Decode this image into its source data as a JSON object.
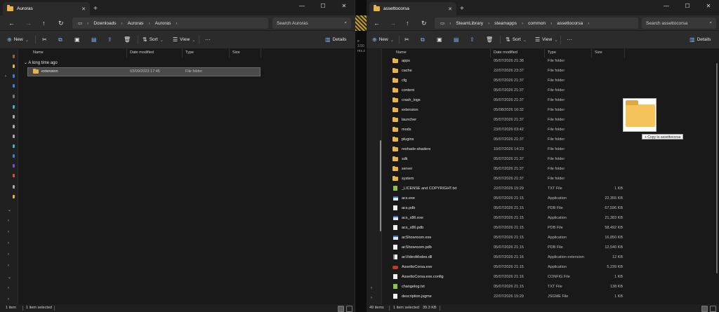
{
  "left": {
    "tab_title": "Auroras",
    "breadcrumbs": [
      "Downloads",
      "Auroras",
      "Auroras"
    ],
    "search_placeholder": "Search Auroras",
    "cmd": {
      "new": "New",
      "sort": "Sort",
      "view": "View",
      "more": "···",
      "details": "Details"
    },
    "columns": {
      "name": "Name",
      "date": "Date modified",
      "type": "Type",
      "size": "Size"
    },
    "group_label": "A long time ago",
    "files": [
      {
        "name": "extension",
        "date": "03/09/2023 17:45",
        "type": "File folder",
        "size": "",
        "icon": "folder-icon"
      }
    ],
    "status": {
      "items": "1 item",
      "selected": "1 item selected"
    }
  },
  "right": {
    "tab_title": "assettocorsa",
    "breadcrumbs": [
      "SteamLibrary",
      "steamapps",
      "common",
      "assettocorsa"
    ],
    "search_placeholder": "Search assettocorsa",
    "cmd": {
      "new": "New",
      "sort": "Sort",
      "view": "View",
      "more": "···",
      "details": "Details"
    },
    "columns": {
      "name": "Name",
      "date": "Date modified",
      "type": "Type",
      "size": "Size"
    },
    "files": [
      {
        "name": "apps",
        "date": "05/07/2026 21:38",
        "type": "File folder",
        "size": "",
        "icon": "folder-icon"
      },
      {
        "name": "cache",
        "date": "22/07/2026 23:37",
        "type": "File folder",
        "size": "",
        "icon": "folder-icon"
      },
      {
        "name": "cfg",
        "date": "05/07/2026 21:37",
        "type": "File folder",
        "size": "",
        "icon": "folder-icon"
      },
      {
        "name": "content",
        "date": "05/07/2026 21:37",
        "type": "File folder",
        "size": "",
        "icon": "folder-icon"
      },
      {
        "name": "crash_logs",
        "date": "05/07/2026 21:37",
        "type": "File folder",
        "size": "",
        "icon": "folder-icon"
      },
      {
        "name": "extension",
        "date": "05/08/2026 16:32",
        "type": "File folder",
        "size": "",
        "icon": "folder-icon"
      },
      {
        "name": "launcher",
        "date": "05/07/2026 21:37",
        "type": "File folder",
        "size": "",
        "icon": "folder-icon"
      },
      {
        "name": "mods",
        "date": "23/07/2026 03:42",
        "type": "File folder",
        "size": "",
        "icon": "folder-icon"
      },
      {
        "name": "plugins",
        "date": "05/07/2026 21:37",
        "type": "File folder",
        "size": "",
        "icon": "folder-icon"
      },
      {
        "name": "reshade-shaders",
        "date": "10/07/2026 14:23",
        "type": "File folder",
        "size": "",
        "icon": "folder-icon"
      },
      {
        "name": "sdk",
        "date": "05/07/2026 21:37",
        "type": "File folder",
        "size": "",
        "icon": "folder-icon"
      },
      {
        "name": "server",
        "date": "05/07/2026 21:37",
        "type": "File folder",
        "size": "",
        "icon": "folder-icon"
      },
      {
        "name": "system",
        "date": "05/07/2026 21:37",
        "type": "File folder",
        "size": "",
        "icon": "folder-icon"
      },
      {
        "name": "_LICENSE and COPYRIGHT.txt",
        "date": "22/07/2026 15:29",
        "type": "TXT File",
        "size": "1 KB",
        "icon": "text-file-icon"
      },
      {
        "name": "acs.exe",
        "date": "05/07/2026 21:15",
        "type": "Application",
        "size": "22,355 KB",
        "icon": "application-icon"
      },
      {
        "name": "acs.pdb",
        "date": "05/07/2026 21:15",
        "type": "PDB File",
        "size": "67,596 KB",
        "icon": "file-icon"
      },
      {
        "name": "acs_x86.exe",
        "date": "05/07/2026 21:15",
        "type": "Application",
        "size": "21,383 KB",
        "icon": "application-icon"
      },
      {
        "name": "acs_x86.pdb",
        "date": "05/07/2026 21:15",
        "type": "PDB File",
        "size": "58,492 KB",
        "icon": "file-icon"
      },
      {
        "name": "acShowroom.exe",
        "date": "05/07/2026 21:15",
        "type": "Application",
        "size": "16,850 KB",
        "icon": "application-icon"
      },
      {
        "name": "acShowroom.pdb",
        "date": "05/07/2026 21:15",
        "type": "PDB File",
        "size": "12,540 KB",
        "icon": "file-icon"
      },
      {
        "name": "acVideoModes.dll",
        "date": "05/07/2026 21:16",
        "type": "Application extension",
        "size": "12 KB",
        "icon": "dll-icon"
      },
      {
        "name": "AssettoCorsa.exe",
        "date": "05/07/2026 21:15",
        "type": "Application",
        "size": "5,239 KB",
        "icon": "assettocorsa-app-icon"
      },
      {
        "name": "AssettoCorsa.exe.config",
        "date": "05/07/2026 21:16",
        "type": "CONFIG File",
        "size": "1 KB",
        "icon": "file-icon"
      },
      {
        "name": "changelog.txt",
        "date": "05/07/2026 21:15",
        "type": "TXT File",
        "size": "138 KB",
        "icon": "text-file-icon"
      },
      {
        "name": "description.jsgme",
        "date": "22/07/2026 15:29",
        "type": "JSGME File",
        "size": "1 KB",
        "icon": "file-icon"
      }
    ],
    "status": {
      "items": "49 items",
      "selected": "1 item selected",
      "size": "39.3 KB"
    }
  },
  "drag_tooltip": "+ Copy to assettocorsa",
  "gap_text": [
    "e 3.50",
    "res.z"
  ]
}
